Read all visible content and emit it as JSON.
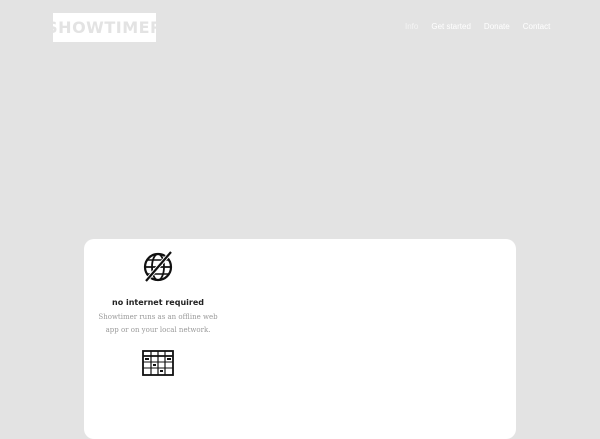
{
  "header": {
    "logo_text": "SHOWTIMER",
    "nav": [
      {
        "label": "Info"
      },
      {
        "label": "Get started"
      },
      {
        "label": "Donate"
      },
      {
        "label": "Contact"
      }
    ]
  },
  "features": [
    {
      "icon": "no-internet-globe-icon",
      "title": "no internet required",
      "description": "Showtimer runs as an offline web app or on your local network."
    },
    {
      "icon": "schedule-grid-icon",
      "title": "",
      "description": ""
    }
  ],
  "colors": {
    "background": "#e3e3e3",
    "card": "#ffffff",
    "nav_text": "#ffffff",
    "title_text": "#222222",
    "desc_text": "#9a9a9a"
  }
}
